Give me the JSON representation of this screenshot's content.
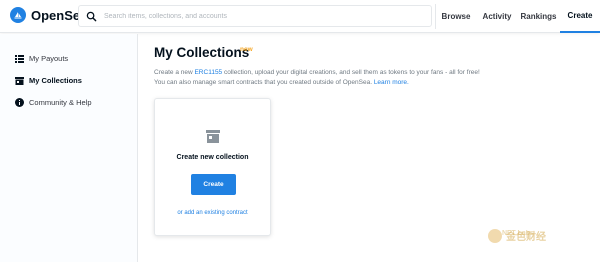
{
  "app": {
    "name": "OpenSea"
  },
  "search": {
    "placeholder": "Search items, collections, and accounts"
  },
  "nav": [
    {
      "label": "Browse"
    },
    {
      "label": "Activity"
    },
    {
      "label": "Rankings"
    },
    {
      "label": "Create",
      "active": true
    }
  ],
  "sidebar": {
    "items": [
      {
        "label": "My Payouts",
        "icon": "list-icon"
      },
      {
        "label": "My Collections",
        "icon": "store-icon",
        "active": true
      },
      {
        "label": "Community & Help",
        "icon": "info-icon"
      }
    ]
  },
  "main": {
    "title": "My Collections",
    "badge": "new",
    "desc_line1_pre": "Create a new ",
    "desc_line1_link": "ERC1155",
    "desc_line1_post": " collection, upload your digital creations, and sell them as tokens to your fans - all for free!",
    "desc_line2_pre": "You can also manage smart contracts that you created outside of OpenSea. ",
    "desc_line2_link": "Learn more."
  },
  "card": {
    "title": "Create new collection",
    "button": "Create",
    "link": "or add an existing contract"
  },
  "watermark": {
    "text": "金色财经",
    "subtext": "NFT Labs"
  },
  "colors": {
    "accent": "#2081e2",
    "badge": "#f5a623",
    "text": "#04111d"
  }
}
